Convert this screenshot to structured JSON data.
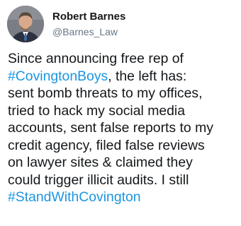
{
  "tweet": {
    "author": {
      "display_name": "Robert Barnes",
      "handle": "@Barnes_Law",
      "avatar_icon": "profile-photo-icon"
    },
    "body_lines": [
      {
        "parts": [
          {
            "text": "Since announcing free rep of",
            "hashtag": false
          }
        ]
      },
      {
        "parts": [
          {
            "text": "#CovingtonBoys",
            "hashtag": true
          },
          {
            "text": ", the left has:",
            "hashtag": false
          }
        ]
      },
      {
        "parts": [
          {
            "text": "sent bomb threats to my offices,",
            "hashtag": false
          }
        ]
      },
      {
        "parts": [
          {
            "text": "tried to hack my social media",
            "hashtag": false
          }
        ]
      },
      {
        "parts": [
          {
            "text": "accounts, sent false reports to my",
            "hashtag": false
          }
        ]
      },
      {
        "parts": [
          {
            "text": "credit agency, filed false reviews",
            "hashtag": false
          }
        ]
      },
      {
        "parts": [
          {
            "text": "on lawyer sites & claimed they",
            "hashtag": false
          }
        ]
      },
      {
        "parts": [
          {
            "text": "could trigger illicit audits. I still",
            "hashtag": false
          }
        ]
      },
      {
        "parts": [
          {
            "text": "#StandWithCovington",
            "hashtag": true
          }
        ]
      }
    ],
    "colors": {
      "hashtag": "#1b95e0",
      "handle": "#657786",
      "text": "#14171a",
      "background": "#ffffff"
    }
  }
}
